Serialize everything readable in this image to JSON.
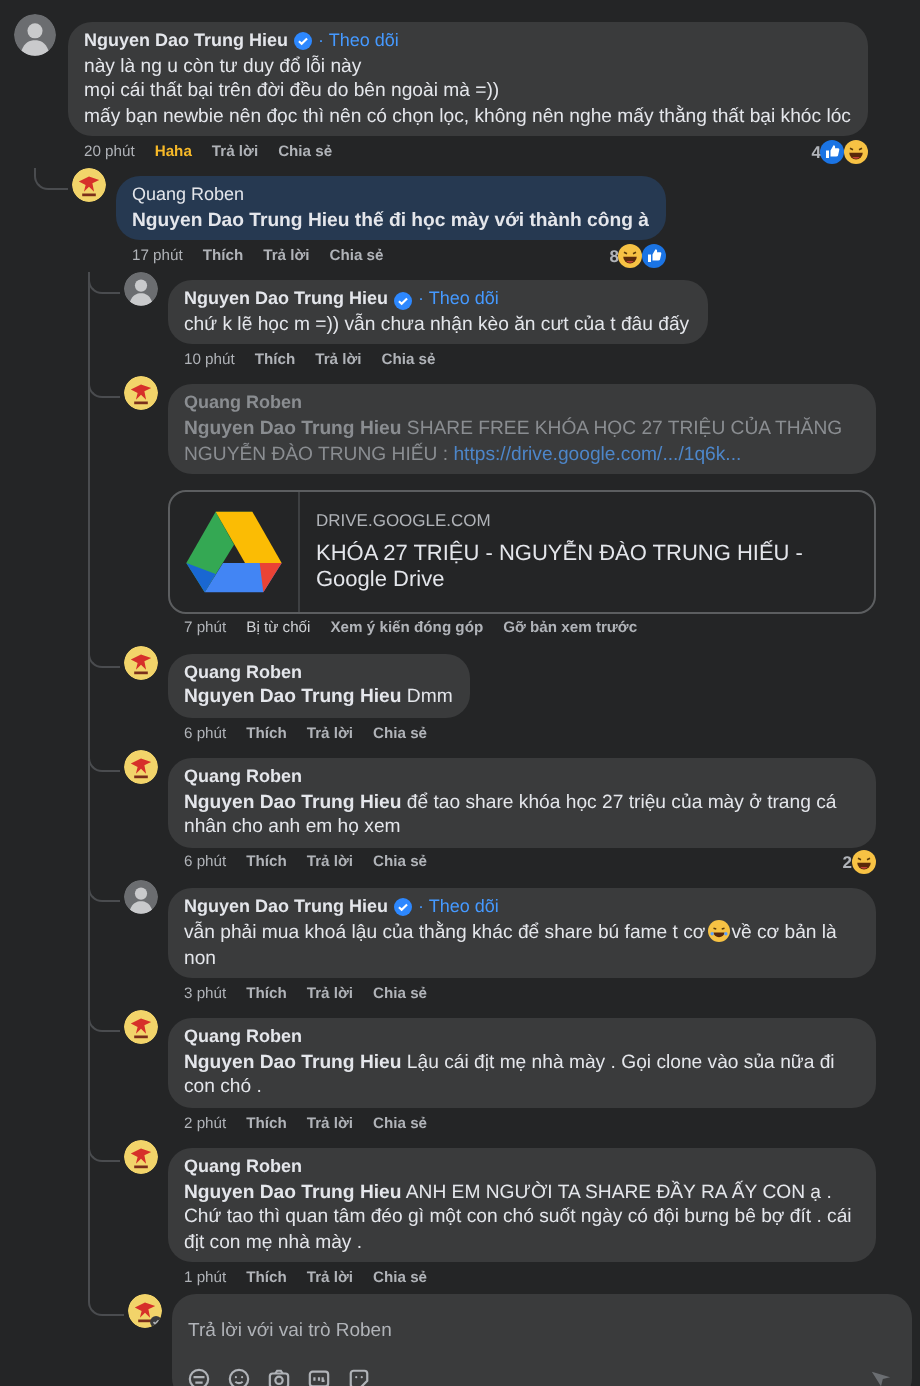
{
  "comments": [
    {
      "author": "Nguyen Dao Trung Hieu",
      "kind": "photo",
      "verified": true,
      "follow": "· Theo dõi",
      "highlighted": false,
      "dimmed": false,
      "body": [
        {
          "kind": "text",
          "text": "này là ng u còn tư duy đổ lỗi này\nmọi cái thất bại trên đời đều do bên ngoài mà =))\nmấy bạn newbie nên đọc thì nên có chọn lọc, không nên nghe mấy thằng thất bại khóc lóc"
        }
      ],
      "time": "20 phút",
      "actions": [
        {
          "label": "Haha",
          "selected": true
        },
        {
          "label": "Trả lời",
          "selected": false
        },
        {
          "label": "Chia sẻ",
          "selected": false
        }
      ],
      "reactions": {
        "count": "4",
        "icons": [
          {
            "kind": "like"
          },
          {
            "kind": "haha"
          }
        ]
      },
      "children": [
        {
          "author": "Quang Roben",
          "kind": "logo",
          "verified": false,
          "highlighted": true,
          "dimmed": false,
          "body": [
            {
              "kind": "text",
              "text": "**Nguyen Dao Trung Hieu** thế đi học mày với thành công à"
            }
          ],
          "time": "17 phút",
          "actions": [
            {
              "label": "Thích",
              "selected": false
            },
            {
              "label": "Trả lời",
              "selected": false
            },
            {
              "label": "Chia sẻ",
              "selected": false
            }
          ],
          "reactions": {
            "count": "8",
            "icons": [
              {
                "kind": "haha"
              },
              {
                "kind": "like"
              }
            ]
          },
          "children": [
            {
              "author": "Nguyen Dao Trung Hieu",
              "kind": "photo",
              "verified": true,
              "follow": "· Theo dõi",
              "highlighted": false,
              "dimmed": false,
              "body": [
                {
                  "kind": "text",
                  "text": "chứ k lẽ học m =)) vẫn chưa nhận kèo ăn cưt của t đâu đấy"
                }
              ],
              "time": "10 phút",
              "actions": [
                {
                  "label": "Thích",
                  "selected": false
                },
                {
                  "label": "Trả lời",
                  "selected": false
                },
                {
                  "label": "Chia sẻ",
                  "selected": false
                }
              ]
            },
            {
              "author": "Quang Roben",
              "kind": "logo",
              "verified": false,
              "highlighted": false,
              "dimmed": true,
              "body": [
                {
                  "kind": "text",
                  "text": "**Nguyen Dao Trung Hieu** SHARE FREE KHÓA HỌC 27 TRIỆU CỦA THĂNG NGUYỄN ĐÀO TRUNG HIẾU : "
                },
                {
                  "kind": "link",
                  "text": "https://drive.google.com/.../1q6k..."
                }
              ],
              "preview": {
                "domain": "DRIVE.GOOGLE.COM",
                "title": "KHÓA 27 TRIỆU - NGUYỄN ĐÀO TRUNG HIẾU - Google Drive"
              },
              "time": "7 phút",
              "status": "Bị từ chối",
              "actions": [
                {
                  "label": "Xem ý kiến đóng góp",
                  "selected": false
                },
                {
                  "label": "Gỡ bản xem trước",
                  "selected": false
                }
              ]
            },
            {
              "author": "Quang Roben",
              "kind": "logo",
              "verified": false,
              "highlighted": false,
              "dimmed": false,
              "body": [
                {
                  "kind": "text",
                  "text": "**Nguyen Dao Trung Hieu** Dmm"
                }
              ],
              "time": "6 phút",
              "actions": [
                {
                  "label": "Thích",
                  "selected": false
                },
                {
                  "label": "Trả lời",
                  "selected": false
                },
                {
                  "label": "Chia sẻ",
                  "selected": false
                }
              ]
            },
            {
              "author": "Quang Roben",
              "kind": "logo",
              "verified": false,
              "highlighted": false,
              "dimmed": false,
              "body": [
                {
                  "kind": "text",
                  "text": "**Nguyen Dao Trung Hieu** để tao share khóa học 27 triệu của mày ở trang cá nhân cho anh em họ xem"
                }
              ],
              "time": "6 phút",
              "actions": [
                {
                  "label": "Thích",
                  "selected": false
                },
                {
                  "label": "Trả lời",
                  "selected": false
                },
                {
                  "label": "Chia sẻ",
                  "selected": false
                }
              ],
              "reactions": {
                "count": "2",
                "icons": [
                  {
                    "kind": "haha"
                  }
                ]
              }
            },
            {
              "author": "Nguyen Dao Trung Hieu",
              "kind": "photo",
              "verified": true,
              "follow": "· Theo dõi",
              "highlighted": false,
              "dimmed": false,
              "body": [
                {
                  "kind": "text",
                  "text": "vẫn phải mua khoá lậu của thằng khác để share bú fame t cơ"
                },
                {
                  "kind": "emoji"
                },
                {
                  "kind": "text",
                  "text": "về cơ bản là non"
                }
              ],
              "time": "3 phút",
              "actions": [
                {
                  "label": "Thích",
                  "selected": false
                },
                {
                  "label": "Trả lời",
                  "selected": false
                },
                {
                  "label": "Chia sẻ",
                  "selected": false
                }
              ]
            },
            {
              "author": "Quang Roben",
              "kind": "logo",
              "verified": false,
              "highlighted": false,
              "dimmed": false,
              "body": [
                {
                  "kind": "text",
                  "text": "**Nguyen Dao Trung Hieu** Lậu cái địt mẹ nhà mày . Gọi clone vào sủa nữa đi con chó ."
                }
              ],
              "time": "2 phút",
              "actions": [
                {
                  "label": "Thích",
                  "selected": false
                },
                {
                  "label": "Trả lời",
                  "selected": false
                },
                {
                  "label": "Chia sẻ",
                  "selected": false
                }
              ]
            },
            {
              "author": "Quang Roben",
              "kind": "logo",
              "verified": false,
              "highlighted": false,
              "dimmed": false,
              "body": [
                {
                  "kind": "text",
                  "text": "**Nguyen Dao Trung Hieu** ANH EM NGƯỜI TA SHARE ĐẦY RA ẤY CON ạ . Chứ tao thì quan tâm đéo gì một con chó suốt ngày có đội bưng bê bợ đít . cái địt con mẹ nhà mày ."
                }
              ],
              "time": "1 phút",
              "actions": [
                {
                  "label": "Thích",
                  "selected": false
                },
                {
                  "label": "Trả lời",
                  "selected": false
                },
                {
                  "label": "Chia sẻ",
                  "selected": false
                }
              ]
            }
          ],
          "reply_box": {
            "placeholder": "Trả lời với vai trò Roben"
          }
        }
      ]
    }
  ]
}
